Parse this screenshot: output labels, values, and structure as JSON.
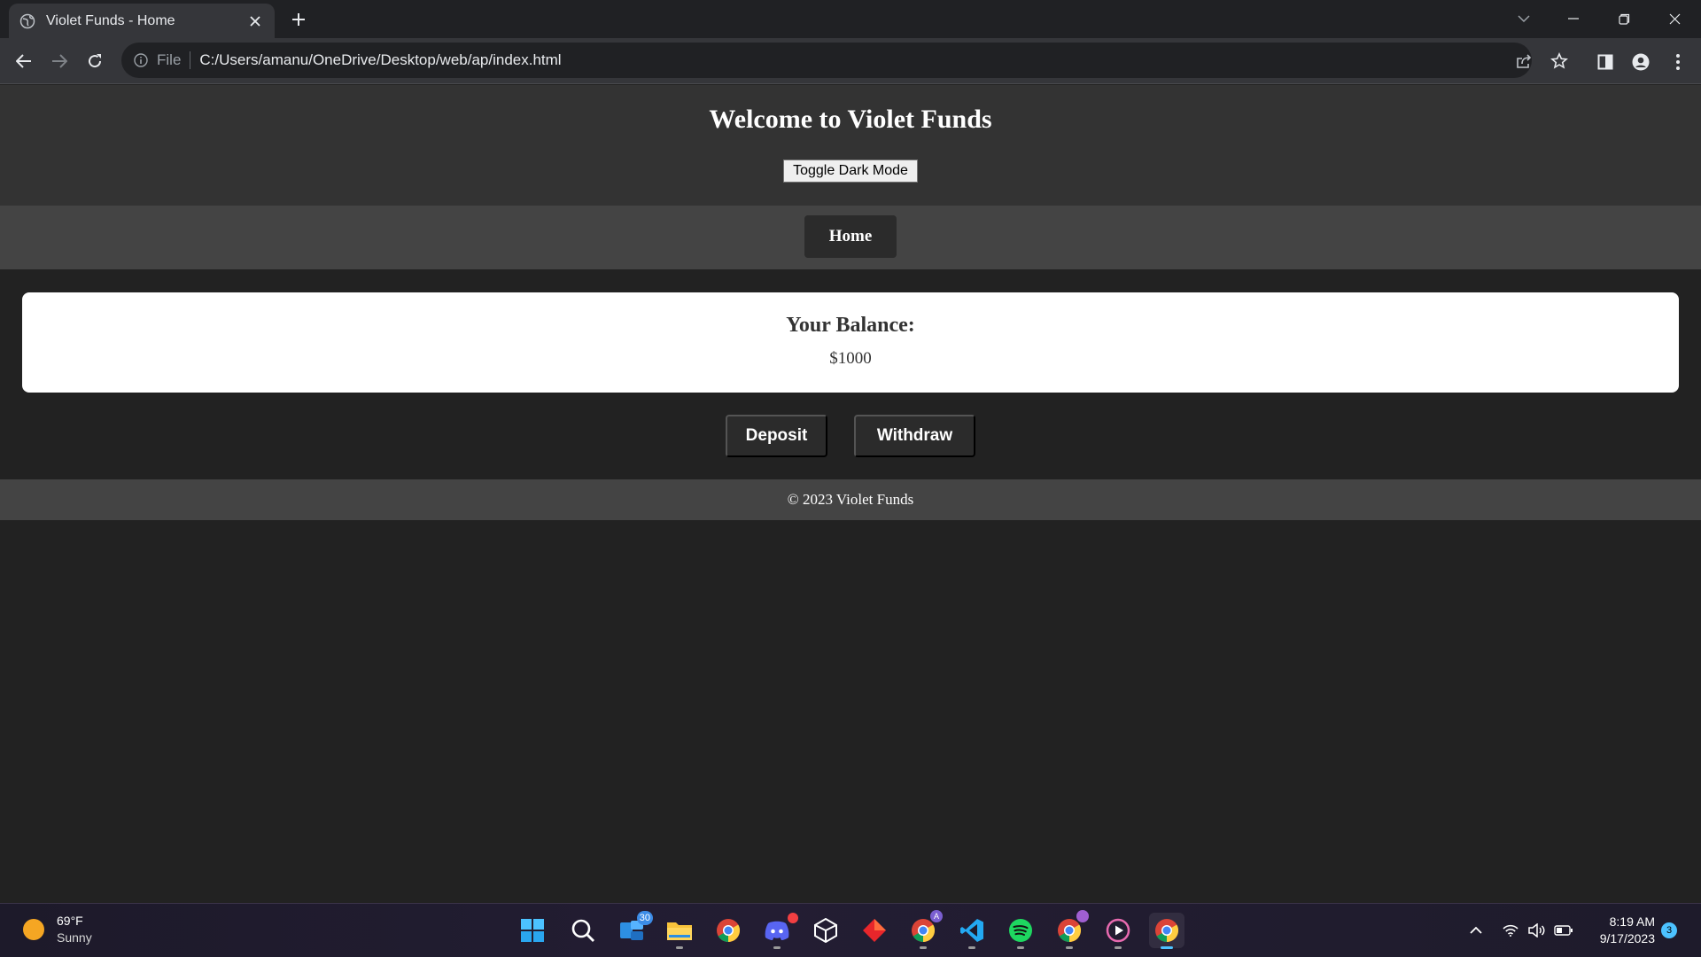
{
  "browser": {
    "tab_title": "Violet Funds - Home",
    "omnibox_scheme": "File",
    "url": "C:/Users/amanu/OneDrive/Desktop/web/ap/index.html"
  },
  "page": {
    "title": "Welcome to Violet Funds",
    "toggle_label": "Toggle Dark Mode",
    "nav": {
      "home_label": "Home"
    },
    "balance": {
      "heading": "Your Balance:",
      "amount": "$1000"
    },
    "actions": {
      "deposit_label": "Deposit",
      "withdraw_label": "Withdraw"
    },
    "footer": "© 2023 Violet Funds"
  },
  "taskbar": {
    "weather": {
      "temp": "69°F",
      "condition": "Sunny"
    },
    "apps": [
      {
        "icon": "windows-start-icon"
      },
      {
        "icon": "search-icon"
      },
      {
        "icon": "widgets-icon",
        "badge": "30"
      },
      {
        "icon": "file-explorer-icon"
      },
      {
        "icon": "chrome-icon"
      },
      {
        "icon": "discord-icon"
      },
      {
        "icon": "unity-icon"
      },
      {
        "icon": "app-red-icon"
      },
      {
        "icon": "chrome-profile-icon"
      },
      {
        "icon": "vscode-icon"
      },
      {
        "icon": "spotify-icon"
      },
      {
        "icon": "chrome-profile2-icon"
      },
      {
        "icon": "media-player-icon"
      },
      {
        "icon": "chrome-active-icon"
      }
    ],
    "time": "8:19 AM",
    "date": "9/17/2023",
    "notification_count": "3"
  },
  "colors": {
    "page_bg": "#222222",
    "header_bg": "#333333",
    "nav_bg": "#444444",
    "button_bg": "#2b2b2b",
    "card_bg": "#ffffff"
  }
}
